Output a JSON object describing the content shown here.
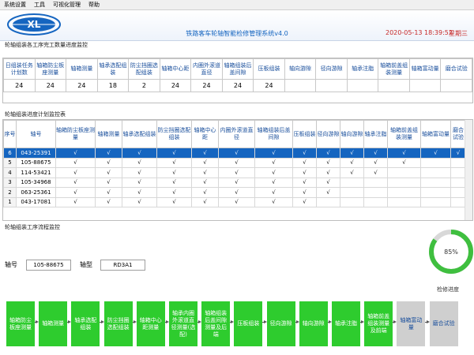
{
  "menu": [
    "系统设置",
    "工具",
    "可视化管理",
    "帮助"
  ],
  "header": {
    "logo_text": "XL",
    "title": "铁路客车轮轴智能检修管理系统v4.0",
    "datetime": "2020-05-13 18:39:52",
    "weekday": "星期三"
  },
  "summary": {
    "section_title": "轮轴组装各工序完工数量进度监控",
    "headers": [
      "日组装任务计划数",
      "轴箱防尘板座测量",
      "轴箱测量",
      "轴承选配组装",
      "防尘挡圈选配组装",
      "轴箱中心距",
      "内圈外滚道直径",
      "轴箱组装后盖间隙",
      "压板组装",
      "轴向游隙",
      "径向游隙",
      "轴承注脂",
      "轴箱前盖组装测量",
      "轴箱富动量",
      "磨合试验"
    ],
    "values": [
      "24",
      "24",
      "24",
      "18",
      "2",
      "24",
      "24",
      "24",
      "24",
      "",
      "",
      "",
      "",
      "",
      ""
    ]
  },
  "plan": {
    "section_title": "轮轴组装进度计划监控表",
    "headers": [
      "序号",
      "轴号",
      "轴箱防尘板座测量",
      "轴箱测量",
      "轴承选配组装",
      "防尘挡圈选配组装",
      "轴箱中心距",
      "内圈外滚道直径",
      "轴箱组装后盖间隙",
      "压板组装",
      "径向游隙",
      "轴向游隙",
      "轴承注脂",
      "轴箱前盖组装测量",
      "轴箱富动量",
      "磨合试验"
    ],
    "rows": [
      [
        "6",
        "043-25391",
        "√",
        "√",
        "√",
        "√",
        "√",
        "√",
        "√",
        "√",
        "√",
        "√",
        "√",
        "√",
        "√",
        "√"
      ],
      [
        "5",
        "105-88675",
        "√",
        "√",
        "√",
        "√",
        "√",
        "√",
        "√",
        "√",
        "√",
        "√",
        "√",
        "√",
        "",
        ""
      ],
      [
        "4",
        "114-53421",
        "√",
        "√",
        "√",
        "√",
        "√",
        "√",
        "√",
        "√",
        "√",
        "√",
        "√",
        "",
        "",
        ""
      ],
      [
        "3",
        "105-34968",
        "√",
        "√",
        "√",
        "√",
        "√",
        "√",
        "√",
        "√",
        "√",
        "",
        "",
        "",
        "",
        ""
      ],
      [
        "2",
        "063-25361",
        "√",
        "√",
        "√",
        "√",
        "√",
        "√",
        "√",
        "√",
        "√",
        "",
        "",
        "",
        "",
        ""
      ],
      [
        "1",
        "043-17081",
        "√",
        "√",
        "√",
        "√",
        "√",
        "√",
        "√",
        "√",
        "",
        "",
        "",
        "",
        "",
        ""
      ]
    ]
  },
  "process": {
    "section_title": "轮轴组装工序流程监控",
    "axle_no_label": "轴号",
    "axle_no_value": "105-88675",
    "axle_type_label": "轴型",
    "axle_type_value": "RD3A1",
    "progress_value": "85%",
    "progress_fraction": 0.85,
    "progress_label": "检修进度",
    "steps": [
      {
        "label": "轴箱防尘板座测量",
        "done": true
      },
      {
        "label": "轴箱测量",
        "done": true
      },
      {
        "label": "轴承选配组装",
        "done": true
      },
      {
        "label": "防尘挡圈选配组装",
        "done": true
      },
      {
        "label": "轴箱中心距测量",
        "done": true
      },
      {
        "label": "轴承内圈外滚道直径测量(选配)",
        "done": true
      },
      {
        "label": "轴箱组装后盖间隙测量及后端",
        "done": true
      },
      {
        "label": "压板组装",
        "done": true
      },
      {
        "label": "径向游隙",
        "done": true
      },
      {
        "label": "轴向游隙",
        "done": true
      },
      {
        "label": "轴承注脂",
        "done": true
      },
      {
        "label": "轴箱前盖组装测量及前端",
        "done": true
      },
      {
        "label": "轴箱富动量",
        "done": false
      },
      {
        "label": "磨合试验",
        "done": false
      }
    ]
  },
  "colors": {
    "accent": "#1565c0",
    "done": "#2ecc2e",
    "pending": "#cfcfcf",
    "datetime": "#c62828"
  }
}
